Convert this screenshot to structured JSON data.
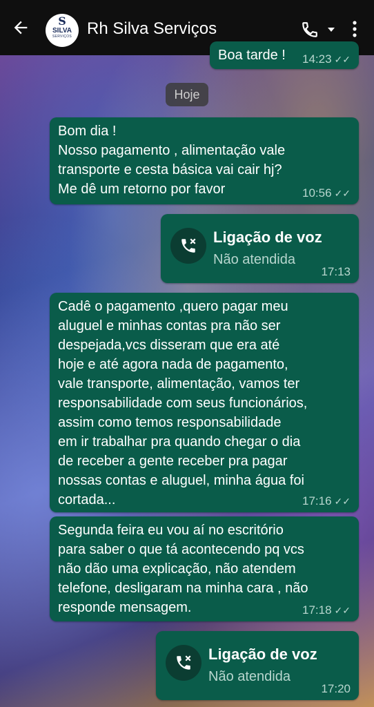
{
  "header": {
    "contact_name": "Rh Silva Serviços",
    "avatar": {
      "letter": "S",
      "name": "SILVA",
      "sub": "SERVIÇOS"
    },
    "icons": [
      "back-arrow-icon",
      "phone-icon",
      "chevron-down-icon",
      "more-vert-icon"
    ]
  },
  "messages": {
    "m0_text": "Boa tarde !",
    "m0_time": "14:23",
    "date_chip": "Hoje",
    "m1_text": "Bom dia !\nNosso pagamento , alimentação vale\ntransporte e cesta básica vai cair hj?\nMe dê um retorno por favor",
    "m1_time": "10:56",
    "call1_title": "Ligação de voz",
    "call1_sub": "Não atendida",
    "call1_time": "17:13",
    "m2_text": "Cadê o pagamento ,quero pagar meu\naluguel e minhas contas pra não ser\ndespejada,vcs disseram que era até\nhoje e até agora nada de pagamento,\nvale transporte, alimentação, vamos ter\nresponsabilidade com seus funcionários,\nassim como temos responsabilidade\nem ir trabalhar pra quando chegar o dia\nde receber a gente receber pra pagar\nnossas contas e aluguel, minha água foi\ncortada...",
    "m2_time": "17:16",
    "m3_text": "Segunda feira eu vou aí no escritório\npara saber o que tá acontecendo pq vcs\nnão dão uma explicação, não atendem\ntelefone, desligaram na minha cara , não\nresponde mensagem.",
    "m3_time": "17:18",
    "call2_title": "Ligação de voz",
    "call2_sub": "Não atendida",
    "call2_time": "17:20"
  },
  "colors": {
    "bubble": "#0a5c4a",
    "header": "#0f0f0f",
    "meta": "#b8d6ce"
  }
}
